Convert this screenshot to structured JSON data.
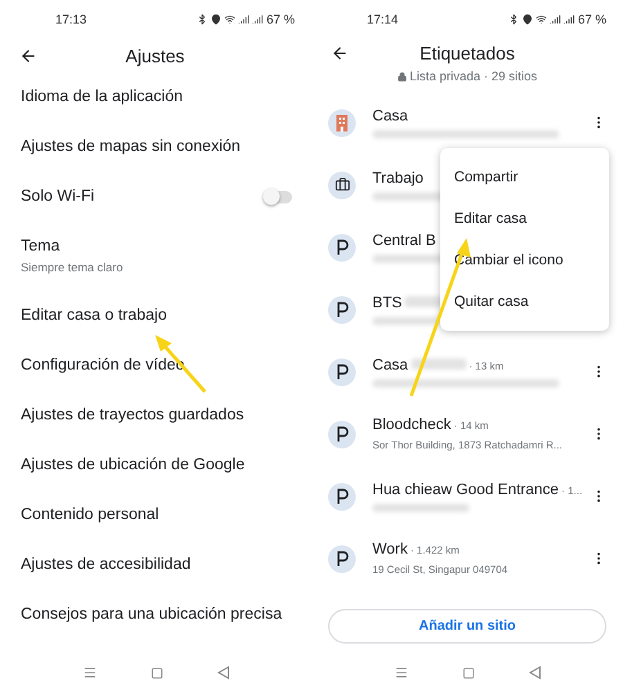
{
  "settings_screen": {
    "status_bar": {
      "time": "17:13",
      "battery": "67 %"
    },
    "title": "Ajustes",
    "items": [
      {
        "label": "Idioma de la aplicación"
      },
      {
        "label": "Ajustes de mapas sin conexión"
      },
      {
        "label": "Solo Wi-Fi",
        "kind": "toggle",
        "on": false
      },
      {
        "label": "Tema",
        "subtitle": "Siempre tema claro"
      },
      {
        "label": "Editar casa o trabajo"
      },
      {
        "label": "Configuración de vídeo"
      },
      {
        "label": "Ajustes de trayectos guardados"
      },
      {
        "label": "Ajustes de ubicación de Google"
      },
      {
        "label": "Contenido personal"
      },
      {
        "label": "Ajustes de accesibilidad"
      },
      {
        "label": "Consejos para una ubicación precisa"
      }
    ]
  },
  "saved_list_screen": {
    "status_bar": {
      "time": "17:14",
      "battery": "67 %"
    },
    "title": "Etiquetados",
    "subtitle": "Lista privada · 29 sitios",
    "places": [
      {
        "kind": "home",
        "name": "Casa",
        "blurred_subtitle": true,
        "menu_button": true
      },
      {
        "kind": "work",
        "name": "Trabajo",
        "blurred_subtitle": true
      },
      {
        "kind": "parking",
        "name": "Central B",
        "blurred_subtitle": true
      },
      {
        "kind": "parking",
        "name": "BTS",
        "blurred_name": true,
        "blurred_subtitle": true
      },
      {
        "kind": "parking",
        "name": "Casa",
        "blurred_name": true,
        "distance": "· 13 km",
        "blurred_subtitle": true,
        "menu_button": true
      },
      {
        "kind": "parking",
        "name": "Bloodcheck",
        "distance": "· 14 km",
        "subtitle": "Sor Thor Building, 1873 Ratchadamri R...",
        "menu_button": true
      },
      {
        "kind": "parking",
        "name": "Hua chieaw Good Entrance",
        "distance": "· 1...",
        "blurred_subtitle": true,
        "menu_button": true
      },
      {
        "kind": "parking",
        "name": "Work",
        "distance": "· 1.422 km",
        "subtitle": "19 Cecil St, Singapur 049704",
        "menu_button": true
      }
    ],
    "menu": {
      "items": [
        "Compartir",
        "Editar casa",
        "Cambiar el icono",
        "Quitar casa"
      ]
    },
    "add_button": "Añadir un sitio"
  }
}
